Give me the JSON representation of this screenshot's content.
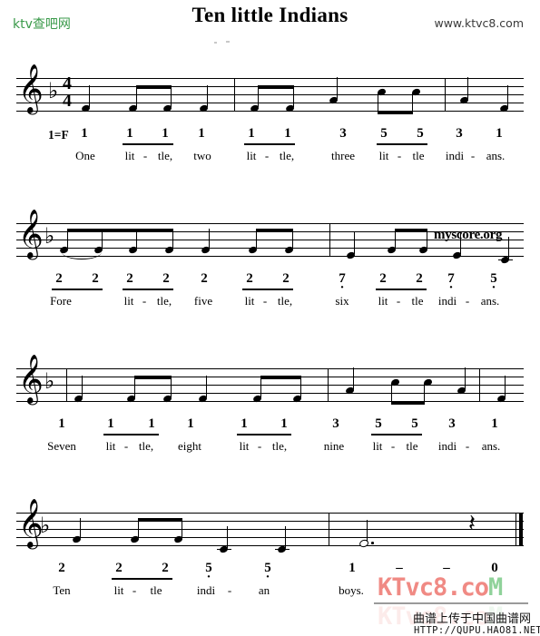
{
  "header": {
    "logo_text": "ktv查吧网",
    "title": "Ten little Indians",
    "site_text": "www.ktvc8.com"
  },
  "score": {
    "key_label": "1=F",
    "time_top": "4",
    "time_bottom": "4",
    "clef": "treble-clef",
    "key_signature": "flat"
  },
  "systems": [
    {
      "id": "system-1",
      "numbers": [
        "1",
        "1",
        "1",
        "1",
        "1",
        "1",
        "3",
        "5",
        "5",
        "3",
        "1"
      ],
      "octave_dots": [
        "",
        "",
        "",
        "",
        "",
        "",
        "",
        "",
        "",
        "",
        ""
      ],
      "lyrics": [
        "One",
        "lit",
        "-",
        "tle,",
        "two",
        "lit",
        "-",
        "tle,",
        "three",
        "lit",
        "-",
        "tle",
        "indi",
        "-",
        "ans."
      ]
    },
    {
      "id": "system-2",
      "numbers": [
        "2",
        "2",
        "2",
        "2",
        "2",
        "2",
        "2",
        "7",
        "2",
        "2",
        "7",
        "5"
      ],
      "octave_dots": [
        "",
        "",
        "",
        "",
        "",
        "",
        "",
        "low",
        "",
        "",
        "low",
        "low"
      ],
      "lyrics": [
        "Fore",
        "lit",
        "-",
        "tle,",
        "five",
        "lit",
        "-",
        "tle,",
        "six",
        "lit",
        "-",
        "tle",
        "indi",
        "-",
        "ans."
      ]
    },
    {
      "id": "system-3",
      "numbers": [
        "1",
        "1",
        "1",
        "1",
        "1",
        "1",
        "3",
        "5",
        "5",
        "3",
        "1"
      ],
      "octave_dots": [
        "",
        "",
        "",
        "",
        "",
        "",
        "",
        "",
        "",
        "",
        ""
      ],
      "lyrics": [
        "Seven",
        "lit",
        "-",
        "tle,",
        "eight",
        "lit",
        "-",
        "tle,",
        "nine",
        "lit",
        "-",
        "tle",
        "indi",
        "-",
        "ans."
      ]
    },
    {
      "id": "system-4",
      "numbers": [
        "2",
        "2",
        "2",
        "5",
        "5",
        "1",
        "–",
        "–",
        "0"
      ],
      "octave_dots": [
        "",
        "",
        "",
        "low",
        "low",
        "",
        "",
        "",
        ""
      ],
      "lyrics": [
        "Ten",
        "lit",
        "-",
        "tle",
        "indi",
        "-",
        "an",
        "boys."
      ]
    }
  ],
  "s1": {
    "n": [
      "1",
      "1",
      "1",
      "1",
      "1",
      "1",
      "3",
      "5",
      "5",
      "3",
      "1"
    ],
    "key": "1=F",
    "l": [
      "One",
      "lit",
      "-",
      "tle,",
      "two",
      "lit",
      "-",
      "tle,",
      "three",
      "lit",
      "-",
      "tle",
      "indi",
      "-",
      "ans."
    ]
  },
  "s2": {
    "n": [
      "2",
      "2",
      "2",
      "2",
      "2",
      "2",
      "2",
      "7",
      "2",
      "2",
      "7",
      "5"
    ],
    "l": [
      "Fore",
      "lit",
      "-",
      "tle,",
      "five",
      "lit",
      "-",
      "tle,",
      "six",
      "lit",
      "-",
      "tle",
      "indi",
      "-",
      "ans."
    ]
  },
  "s3": {
    "n": [
      "1",
      "1",
      "1",
      "1",
      "1",
      "1",
      "3",
      "5",
      "5",
      "3",
      "1"
    ],
    "l": [
      "Seven",
      "lit",
      "-",
      "tle,",
      "eight",
      "lit",
      "-",
      "tle,",
      "nine",
      "lit",
      "-",
      "tle",
      "indi",
      "-",
      "ans."
    ]
  },
  "s4": {
    "n": [
      "2",
      "2",
      "2",
      "5",
      "5",
      "1",
      "–",
      "–",
      "0"
    ],
    "l": [
      "Ten",
      "lit",
      "-",
      "tle",
      "indi",
      "-",
      "an",
      "boys."
    ]
  },
  "glyphs": {
    "treble": "𝄞",
    "flat": "♭",
    "quarter_rest": "𝄽",
    "dash": "–"
  },
  "watermarks": {
    "myscore": "myscore.org",
    "ktv_red": "KTvc8.co",
    "ktv_green": "M",
    "cn_text": "曲谱上传于中国曲谱网",
    "url": "HTTP://QUPU.HAO81.NET"
  },
  "colors": {
    "logo_green": "#3a9a4a",
    "wm_red": "#f08a84",
    "wm_green": "#8fd29a",
    "ink": "#000000"
  }
}
